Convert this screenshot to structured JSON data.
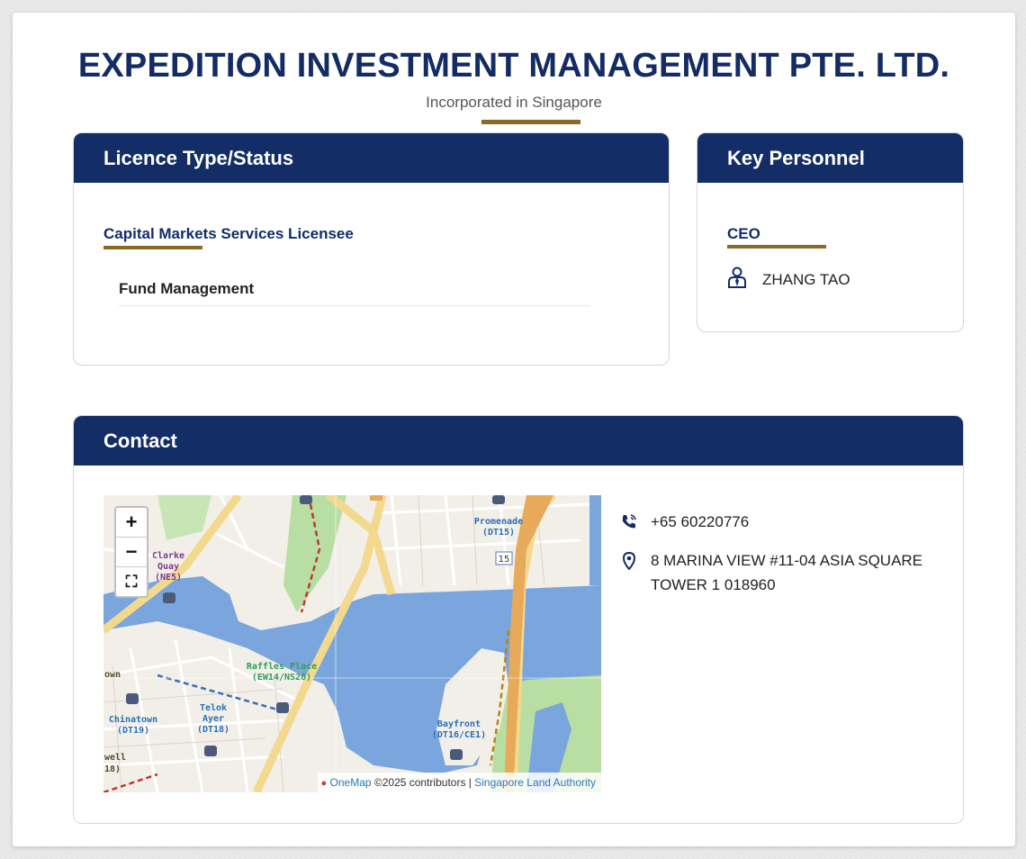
{
  "header": {
    "company_name": "EXPEDITION INVESTMENT MANAGEMENT PTE. LTD.",
    "incorporation": "Incorporated in Singapore"
  },
  "licence": {
    "heading": "Licence Type/Status",
    "type": "Capital Markets Services Licensee",
    "activities": [
      "Fund Management"
    ]
  },
  "personnel": {
    "heading": "Key Personnel",
    "role": "CEO",
    "name": "ZHANG TAO"
  },
  "contact": {
    "heading": "Contact",
    "phone": "+65 60220776",
    "address": "8 MARINA VIEW #11-04 ASIA SQUARE TOWER 1 018960",
    "map": {
      "zoom_in": "+",
      "zoom_out": "−",
      "fullscreen": "⛶",
      "attribution_link": "OneMap",
      "attribution_text": " ©2025 contributors | ",
      "attribution_authority": "Singapore Land Authority",
      "labels": {
        "clarke_quay": "Clarke Quay (NE5)",
        "promenade": "Promenade (DT15)",
        "raffles_place": "Raffles Place (EW14/NS26)",
        "telok_ayer": "Telok Ayer (DT18)",
        "chinatown": "Chinatown (DT19)",
        "bayfront": "Bayfront (DT16/CE1)",
        "town": "own",
        "well": "well",
        "eighteen": "18)",
        "road15": "15"
      }
    }
  },
  "colors": {
    "navy": "#132d66",
    "gold": "#8a6a24"
  }
}
